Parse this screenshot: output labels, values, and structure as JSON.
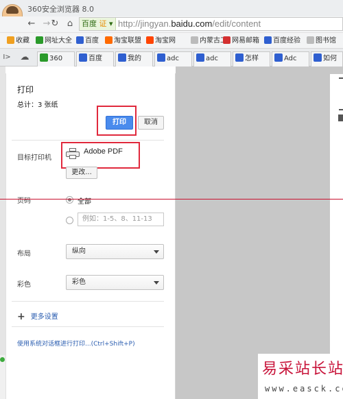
{
  "browser": {
    "title": "360安全浏览器 8.0",
    "cert_label": "百度",
    "cert_badge": "证",
    "url_prefix": "http://jingyan.",
    "url_domain": "baidu.com",
    "url_path": "/edit/content"
  },
  "bookmarks": [
    {
      "label": "收藏",
      "icon": "star-icon",
      "color": "#f0a020"
    },
    {
      "label": "网址大全",
      "icon": "360-icon",
      "color": "#2a9a2a"
    },
    {
      "label": "百度",
      "icon": "baidu-paw-icon",
      "color": "#2f5fd0"
    },
    {
      "label": "淘宝联盟",
      "icon": "taobao-icon",
      "color": "#ff6a00"
    },
    {
      "label": "淘宝网",
      "icon": "taobao-icon",
      "color": "#ff4400"
    },
    {
      "label": "内蒙古工",
      "icon": "page-icon",
      "color": "#bbbbbb"
    },
    {
      "label": "网易邮箱",
      "icon": "mail-icon",
      "color": "#d43030"
    },
    {
      "label": "百度经验",
      "icon": "baidu-paw-icon",
      "color": "#2f5fd0"
    },
    {
      "label": "图书馆",
      "icon": "page-icon",
      "color": "#bbbbbb"
    }
  ],
  "tabs": [
    {
      "label": "360",
      "icon": "360-icon"
    },
    {
      "label": "百度",
      "icon": "baidu-paw-icon"
    },
    {
      "label": "我的",
      "icon": "baidu-paw-icon"
    },
    {
      "label": "adc",
      "icon": "baidu-paw-icon"
    },
    {
      "label": "adc",
      "icon": "baidu-paw-icon"
    },
    {
      "label": "怎样",
      "icon": "baidu-paw-icon"
    },
    {
      "label": "Adc",
      "icon": "baidu-paw-icon"
    },
    {
      "label": "如何",
      "icon": "baidu-paw-icon"
    }
  ],
  "print_dialog": {
    "title": "打印",
    "total": "总计：3 张纸",
    "print_button": "打印",
    "cancel_button": "取消",
    "destination_label": "目标打印机",
    "printer_name": "Adobe PDF",
    "change_button": "更改...",
    "pages_label": "页码",
    "pages_all": "全部",
    "pages_range_placeholder": "例如：1-5、8、11-13",
    "layout_label": "布局",
    "layout_value": "纵向",
    "color_label": "彩色",
    "color_value": "彩色",
    "more_settings": "更多设置",
    "system_dialog_link": "使用系统对话框进行打印...(Ctrl+Shift+P)"
  },
  "watermark": {
    "text": "易采站长站",
    "url": "www.easck.com"
  },
  "accent_colors": {
    "print_button": "#4a8bed",
    "highlight_box": "#e0283c",
    "link": "#2a5db0"
  }
}
